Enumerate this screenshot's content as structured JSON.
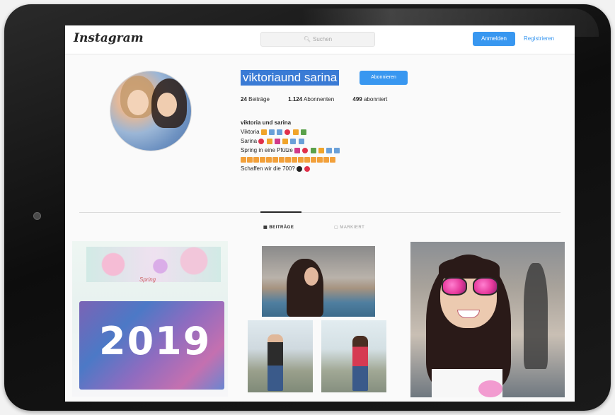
{
  "app": {
    "logo": "Instagram",
    "search_placeholder": "Suchen",
    "login_label": "Anmelden",
    "signup_label": "Registrieren"
  },
  "profile": {
    "username": "viktoriaund sarina",
    "follow_label": "Abonnieren",
    "stats": {
      "posts_count": "24",
      "posts_label": "Beiträge",
      "followers_count": "1.124",
      "followers_label": "Abonnenten",
      "following_count": "499",
      "following_label": "abonniert"
    },
    "bio": {
      "name": "viktoria und sarina",
      "line1": "Viktoria",
      "line2": "Sarina",
      "line3": "Spring in eine Pfütze",
      "line5": "Schaffen wir die 700?"
    }
  },
  "tabs": {
    "posts": "BEITRÄGE",
    "tagged": "MARKIERT"
  },
  "posts": {
    "post1_banner": "Spring",
    "post1_year": "2019"
  },
  "colors": {
    "accent": "#3897f0",
    "text": "#262626",
    "selection": "#3a7bd5"
  }
}
